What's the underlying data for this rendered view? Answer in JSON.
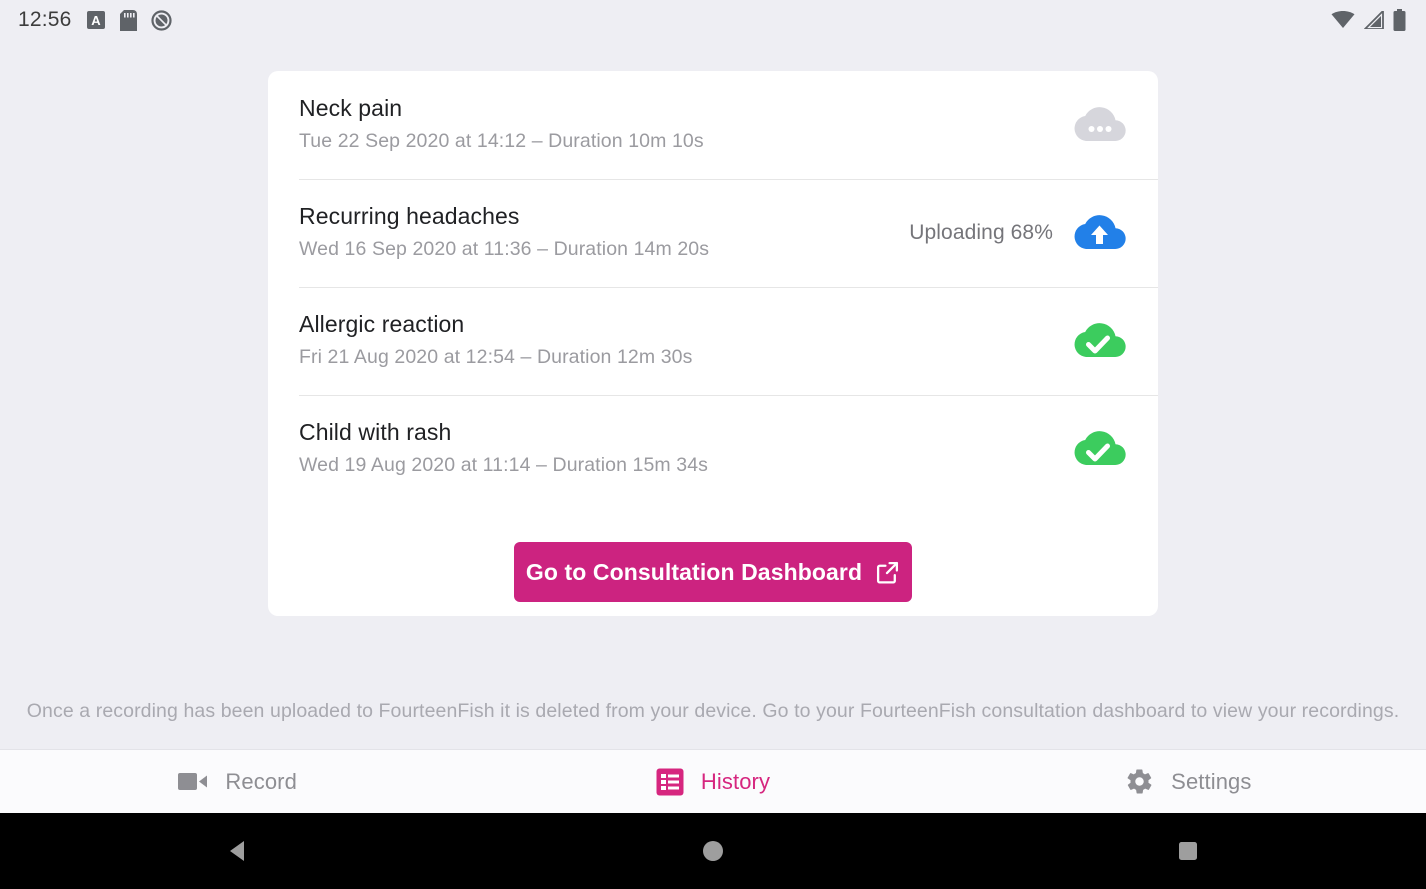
{
  "status_bar": {
    "clock": "12:56",
    "left_icons": [
      "screenshot-a-icon",
      "sd-card-icon",
      "do-not-disturb-icon"
    ],
    "right_icons": [
      "wifi-icon",
      "cell-signal-icon",
      "battery-icon"
    ]
  },
  "card": {
    "recordings": [
      {
        "title": "Neck pain",
        "subtitle": "Tue 22 Sep 2020 at 14:12 – Duration 10m 10s",
        "status_text": "",
        "status_icon": "cloud-pending-icon"
      },
      {
        "title": "Recurring headaches",
        "subtitle": "Wed 16 Sep 2020 at 11:36 – Duration 14m 20s",
        "status_text": "Uploading 68%",
        "status_icon": "cloud-upload-icon"
      },
      {
        "title": "Allergic reaction",
        "subtitle": "Fri 21 Aug 2020 at 12:54 – Duration 12m 30s",
        "status_text": "",
        "status_icon": "cloud-done-icon"
      },
      {
        "title": "Child with rash",
        "subtitle": "Wed 19 Aug 2020 at 11:14 – Duration 15m 34s",
        "status_text": "",
        "status_icon": "cloud-done-icon"
      }
    ],
    "dashboard_button_label": "Go to Consultation Dashboard"
  },
  "footer_note": "Once a recording has been uploaded to FourteenFish it is deleted from your device. Go to your FourteenFish consultation dashboard to view your recordings.",
  "tabs": [
    {
      "label": "Record",
      "icon": "video-camera-icon",
      "active": false
    },
    {
      "label": "History",
      "icon": "list-icon",
      "active": true
    },
    {
      "label": "Settings",
      "icon": "gear-icon",
      "active": false
    }
  ],
  "nav_bar": {
    "back": "back-triangle-icon",
    "home": "home-circle-icon",
    "recents": "recents-square-icon"
  },
  "colors": {
    "accent_pink": "#cc2380",
    "tab_active_pink": "#d6267f",
    "upload_blue": "#2280e8",
    "done_green": "#3ccc5e",
    "pending_grey": "#d6d6dc",
    "page_background": "#eeeef3",
    "card_background": "#ffffff"
  }
}
